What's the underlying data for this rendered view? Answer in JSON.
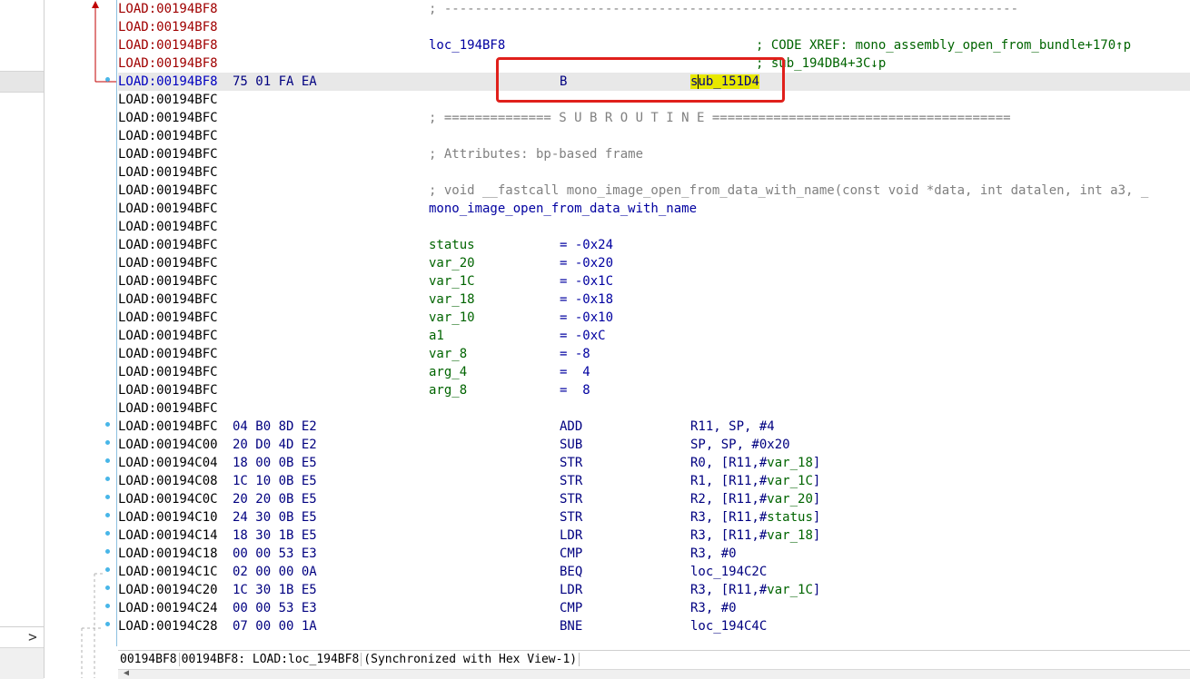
{
  "listing": {
    "rows": [
      {
        "addr": "LOAD:00194BF8",
        "style": "red",
        "bytes": "",
        "comment": "; ---------------------------------------------------------------------------"
      },
      {
        "addr": "LOAD:00194BF8",
        "style": "red"
      },
      {
        "addr": "LOAD:00194BF8",
        "style": "red",
        "label": "loc_194BF8",
        "xref": "; CODE XREF: mono_assembly_open_from_bundle+170↑p"
      },
      {
        "addr": "LOAD:00194BF8",
        "style": "red",
        "xref": "; sub_194DB4+3C↓p"
      },
      {
        "addr": "LOAD:00194BF8",
        "style": "blue",
        "bytes": "75 01 FA EA",
        "mnem": "B",
        "operand_pre": "",
        "operand_hl": "sub_151D4",
        "selected": true
      },
      {
        "addr": "LOAD:00194BFC"
      },
      {
        "addr": "LOAD:00194BFC",
        "comment": "; ============== S U B R O U T I N E ======================================="
      },
      {
        "addr": "LOAD:00194BFC"
      },
      {
        "addr": "LOAD:00194BFC",
        "comment": "; Attributes: bp-based frame"
      },
      {
        "addr": "LOAD:00194BFC"
      },
      {
        "addr": "LOAD:00194BFC",
        "comment": "; void __fastcall mono_image_open_from_data_with_name(const void *data, int datalen, int a3, _"
      },
      {
        "addr": "LOAD:00194BFC",
        "label": "mono_image_open_from_data_with_name"
      },
      {
        "addr": "LOAD:00194BFC"
      },
      {
        "addr": "LOAD:00194BFC",
        "stk": "status",
        "stkval": "= -0x24"
      },
      {
        "addr": "LOAD:00194BFC",
        "stk": "var_20",
        "stkval": "= -0x20"
      },
      {
        "addr": "LOAD:00194BFC",
        "stk": "var_1C",
        "stkval": "= -0x1C"
      },
      {
        "addr": "LOAD:00194BFC",
        "stk": "var_18",
        "stkval": "= -0x18"
      },
      {
        "addr": "LOAD:00194BFC",
        "stk": "var_10",
        "stkval": "= -0x10"
      },
      {
        "addr": "LOAD:00194BFC",
        "stk": "a1",
        "stkval": "= -0xC"
      },
      {
        "addr": "LOAD:00194BFC",
        "stk": "var_8",
        "stkval": "= -8"
      },
      {
        "addr": "LOAD:00194BFC",
        "stk": "arg_4",
        "stkval": "=  4"
      },
      {
        "addr": "LOAD:00194BFC",
        "stk": "arg_8",
        "stkval": "=  8"
      },
      {
        "addr": "LOAD:00194BFC"
      },
      {
        "addr": "LOAD:00194BFC",
        "bytes": "04 B0 8D E2",
        "mnem": "ADD",
        "operand": "R11, SP, #4",
        "dot": true
      },
      {
        "addr": "LOAD:00194C00",
        "bytes": "20 D0 4D E2",
        "mnem": "SUB",
        "operand": "SP, SP, #0x20",
        "dot": true
      },
      {
        "addr": "LOAD:00194C04",
        "bytes": "18 00 0B E5",
        "mnem": "STR",
        "operand": "R0, [R11,#",
        "opvar": "var_18",
        "opend": "]",
        "dot": true
      },
      {
        "addr": "LOAD:00194C08",
        "bytes": "1C 10 0B E5",
        "mnem": "STR",
        "operand": "R1, [R11,#",
        "opvar": "var_1C",
        "opend": "]",
        "dot": true
      },
      {
        "addr": "LOAD:00194C0C",
        "bytes": "20 20 0B E5",
        "mnem": "STR",
        "operand": "R2, [R11,#",
        "opvar": "var_20",
        "opend": "]",
        "dot": true
      },
      {
        "addr": "LOAD:00194C10",
        "bytes": "24 30 0B E5",
        "mnem": "STR",
        "operand": "R3, [R11,#",
        "opvar": "status",
        "opend": "]",
        "dot": true
      },
      {
        "addr": "LOAD:00194C14",
        "bytes": "18 30 1B E5",
        "mnem": "LDR",
        "operand": "R3, [R11,#",
        "opvar": "var_18",
        "opend": "]",
        "dot": true
      },
      {
        "addr": "LOAD:00194C18",
        "bytes": "00 00 53 E3",
        "mnem": "CMP",
        "operand": "R3, #0",
        "dot": true
      },
      {
        "addr": "LOAD:00194C1C",
        "bytes": "02 00 00 0A",
        "mnem": "BEQ",
        "operand": "loc_194C2C",
        "dot": true
      },
      {
        "addr": "LOAD:00194C20",
        "bytes": "1C 30 1B E5",
        "mnem": "LDR",
        "operand": "R3, [R11,#",
        "opvar": "var_1C",
        "opend": "]",
        "dot": true
      },
      {
        "addr": "LOAD:00194C24",
        "bytes": "00 00 53 E3",
        "mnem": "CMP",
        "operand": "R3, #0",
        "dot": true
      },
      {
        "addr": "LOAD:00194C28",
        "bytes": "07 00 00 1A",
        "mnem": "BNE",
        "operand": "loc_194C4C",
        "dot": true
      }
    ]
  },
  "status_bar": {
    "offset": "00194BF8",
    "location": "00194BF8: LOAD:loc_194BF8",
    "sync": "(Synchronized with Hex View-1)"
  },
  "left_pane": {
    "expand_glyph": ">"
  },
  "colors": {
    "annotation_box": "#e0201b",
    "highlight": "#e8e800",
    "selected_row": "#e8e8e8"
  }
}
